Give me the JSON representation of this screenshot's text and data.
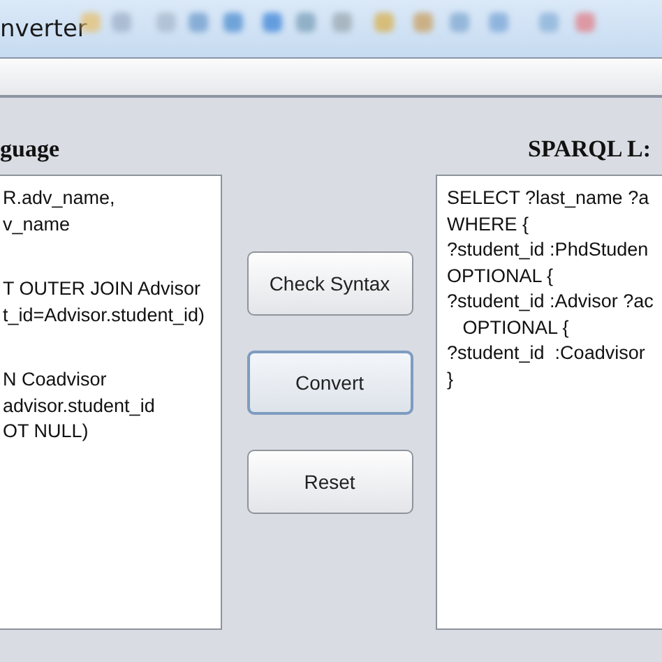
{
  "window": {
    "title": "nverter"
  },
  "left_panel": {
    "heading": "guage",
    "blocks": [
      [
        "R.adv_name,",
        "v_name"
      ],
      [
        "T OUTER JOIN Advisor",
        "t_id=Advisor.student_id)"
      ],
      [
        "N Coadvisor",
        "advisor.student_id",
        "OT NULL)"
      ]
    ]
  },
  "buttons": [
    {
      "label": "Check Syntax",
      "focused": false
    },
    {
      "label": "Convert",
      "focused": true
    },
    {
      "label": "Reset",
      "focused": false
    }
  ],
  "right_panel": {
    "heading": "SPARQL L:",
    "lines": [
      "SELECT ?last_name ?a",
      "WHERE {",
      "?student_id :PhdStuden",
      "OPTIONAL {",
      "?student_id :Advisor ?ac",
      "   OPTIONAL {",
      "?student_id  :Coadvisor",
      "}"
    ]
  }
}
